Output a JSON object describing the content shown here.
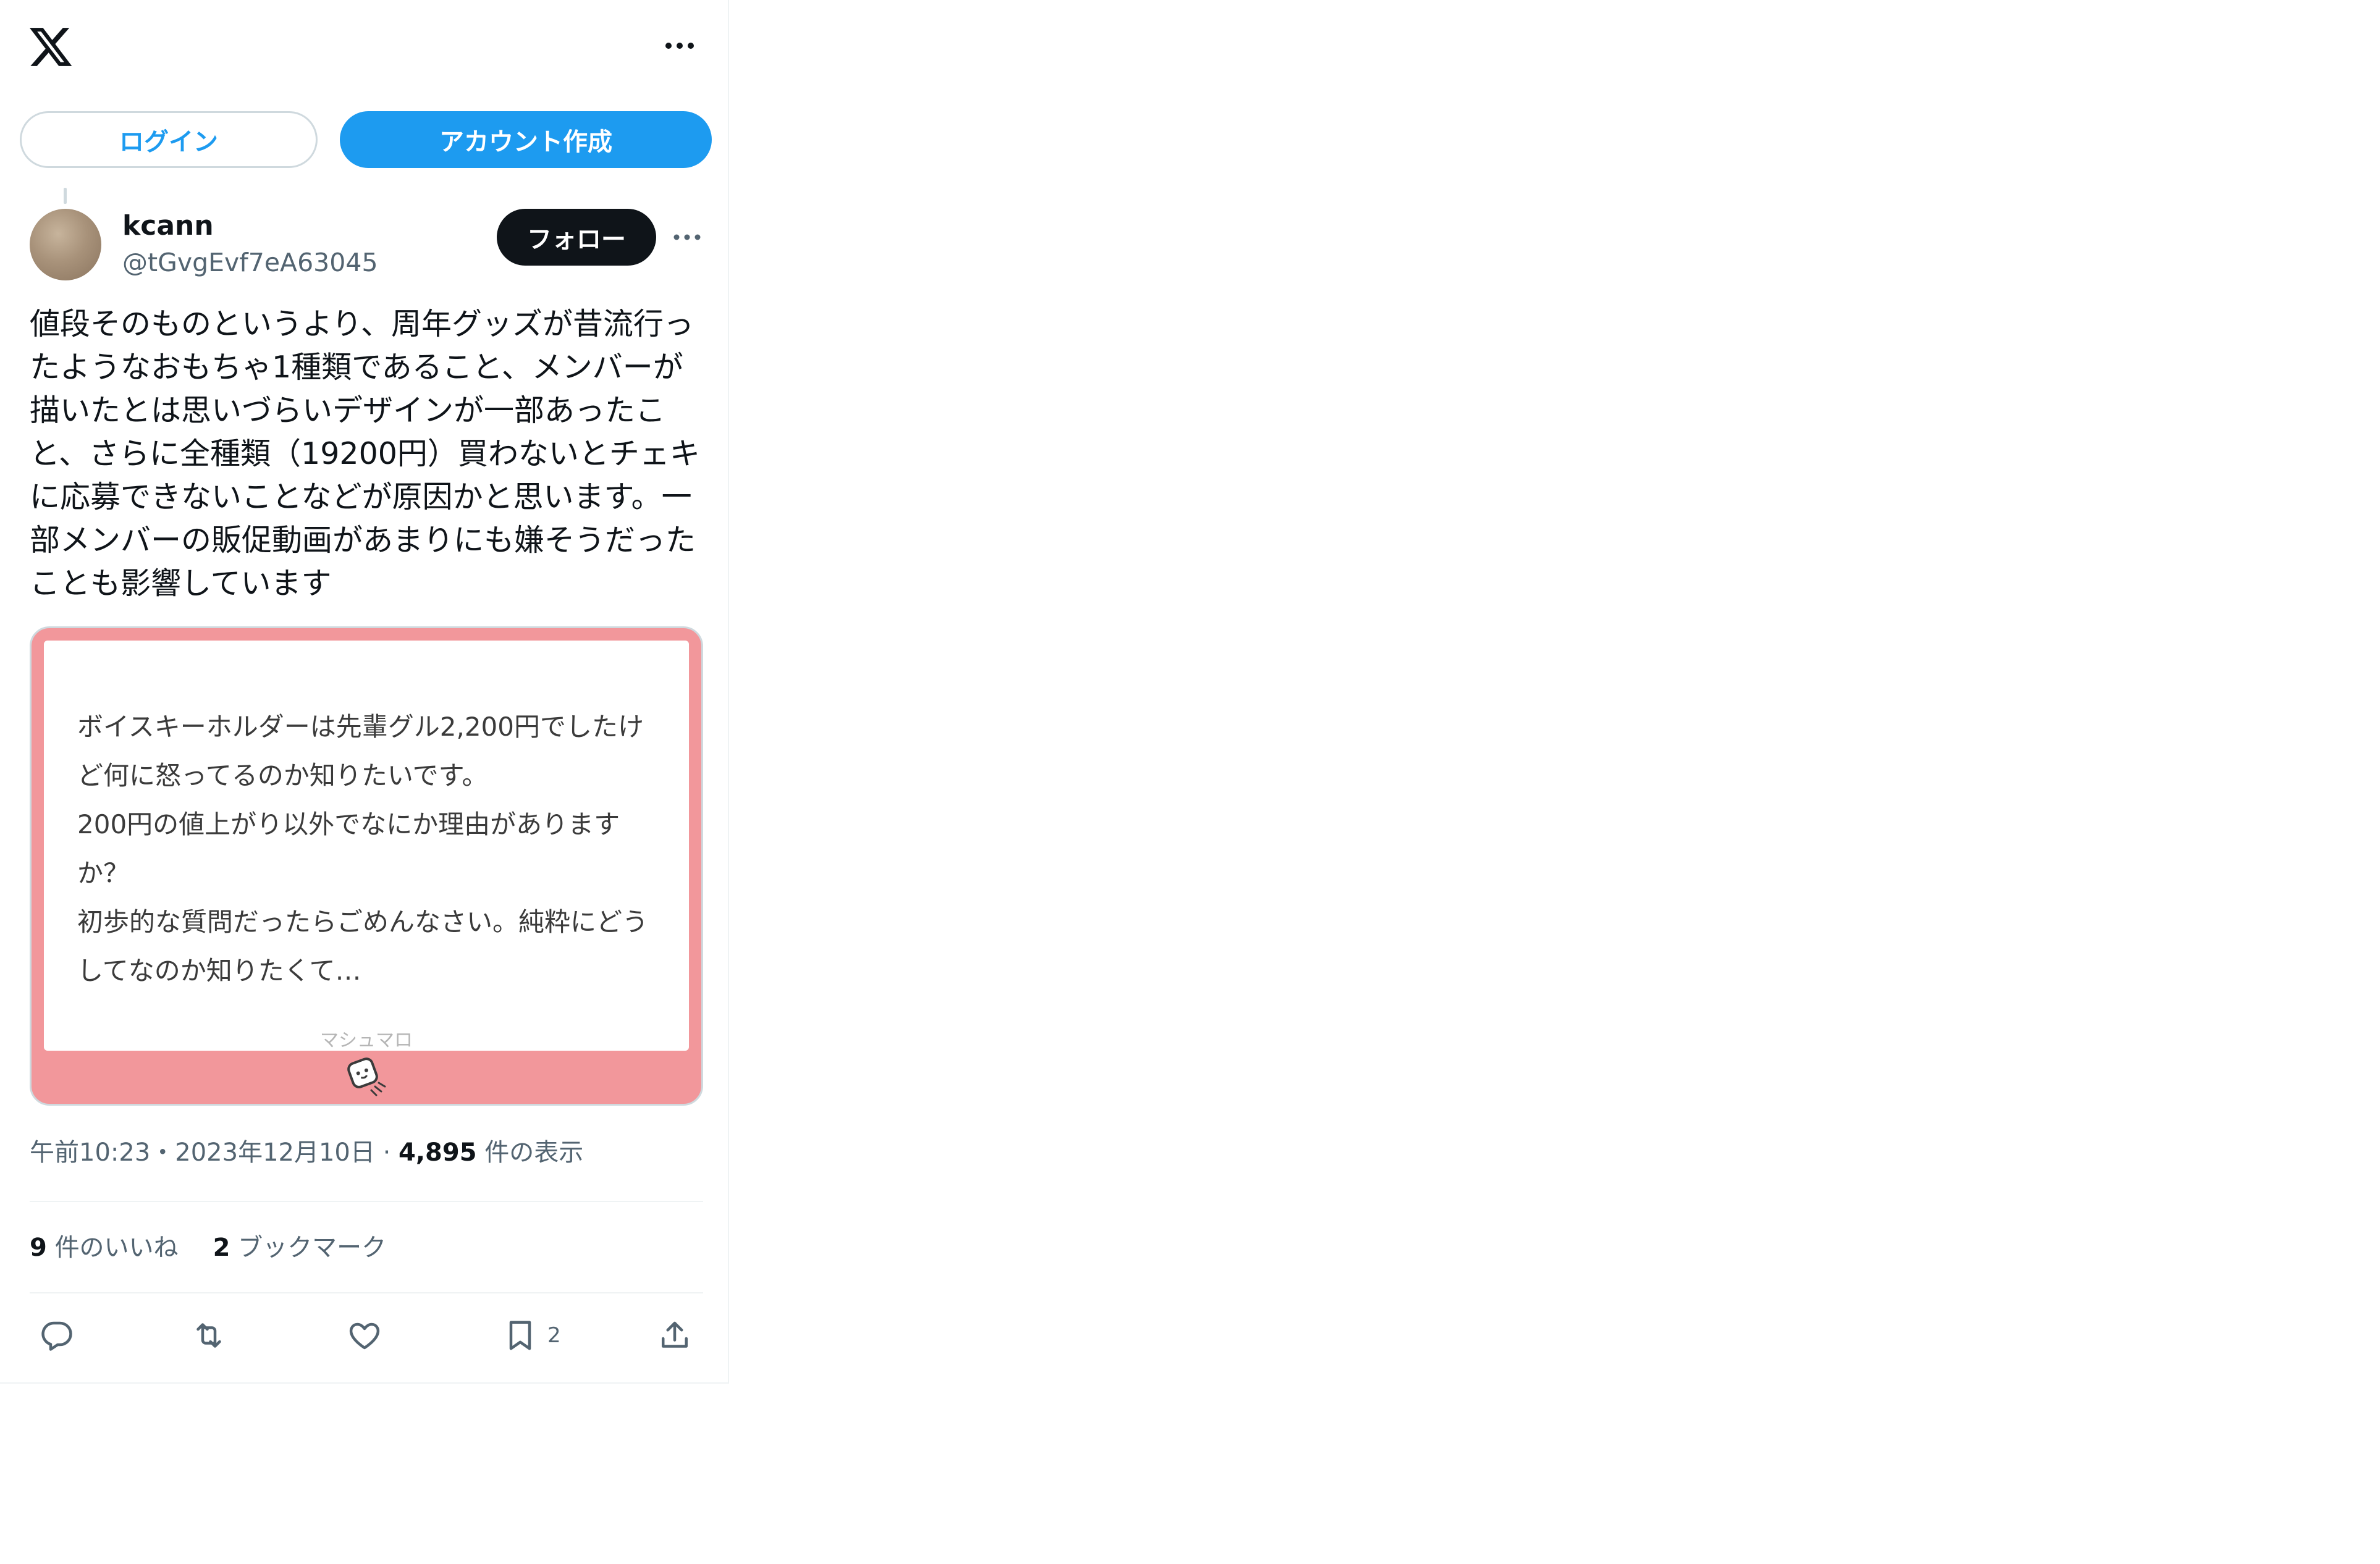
{
  "header": {
    "logo_icon": "x-logo-icon",
    "more_icon": "more-horizontal-icon"
  },
  "auth": {
    "login_label": "ログイン",
    "signup_label": "アカウント作成"
  },
  "author": {
    "name": "kcann",
    "handle": "@tGvgEvf7eA63045",
    "follow_label": "フォロー"
  },
  "tweet": {
    "text": "値段そのものというより、周年グッズが昔流行ったようなおもちゃ1種類であること、メンバーが描いたとは思いづらいデザインが一部あったこと、さらに全種類（19200円）買わないとチェキに応募できないことなどが原因かと思います。一部メンバーの販促動画があまりにも嫌そうだったことも影響しています"
  },
  "card": {
    "question": "ボイスキーホルダーは先輩グル2,200円でしたけど何に怒ってるのか知りたいです。\n200円の値上がり以外でなにか理由がありますか？\n初歩的な質問だったらごめんなさい。純粋にどうしてなのか知りたくて…",
    "brand": "マシュマロ",
    "background_color": "#f2979b"
  },
  "meta": {
    "time": "午前10:23",
    "separator": "・",
    "date": "2023年12月10日",
    "dot": "·",
    "views_count": "4,895",
    "views_label": "件の表示"
  },
  "stats": {
    "likes_count": "9",
    "likes_label": "件のいいね",
    "bookmarks_count": "2",
    "bookmarks_label": "ブックマーク"
  },
  "actions": {
    "reply_icon": "reply-icon",
    "retweet_icon": "retweet-icon",
    "like_icon": "heart-icon",
    "bookmark_icon": "bookmark-icon",
    "bookmark_count": "2",
    "share_icon": "share-icon"
  },
  "colors": {
    "accent": "#1d9bf0",
    "text": "#0f1419",
    "secondary": "#536471"
  }
}
